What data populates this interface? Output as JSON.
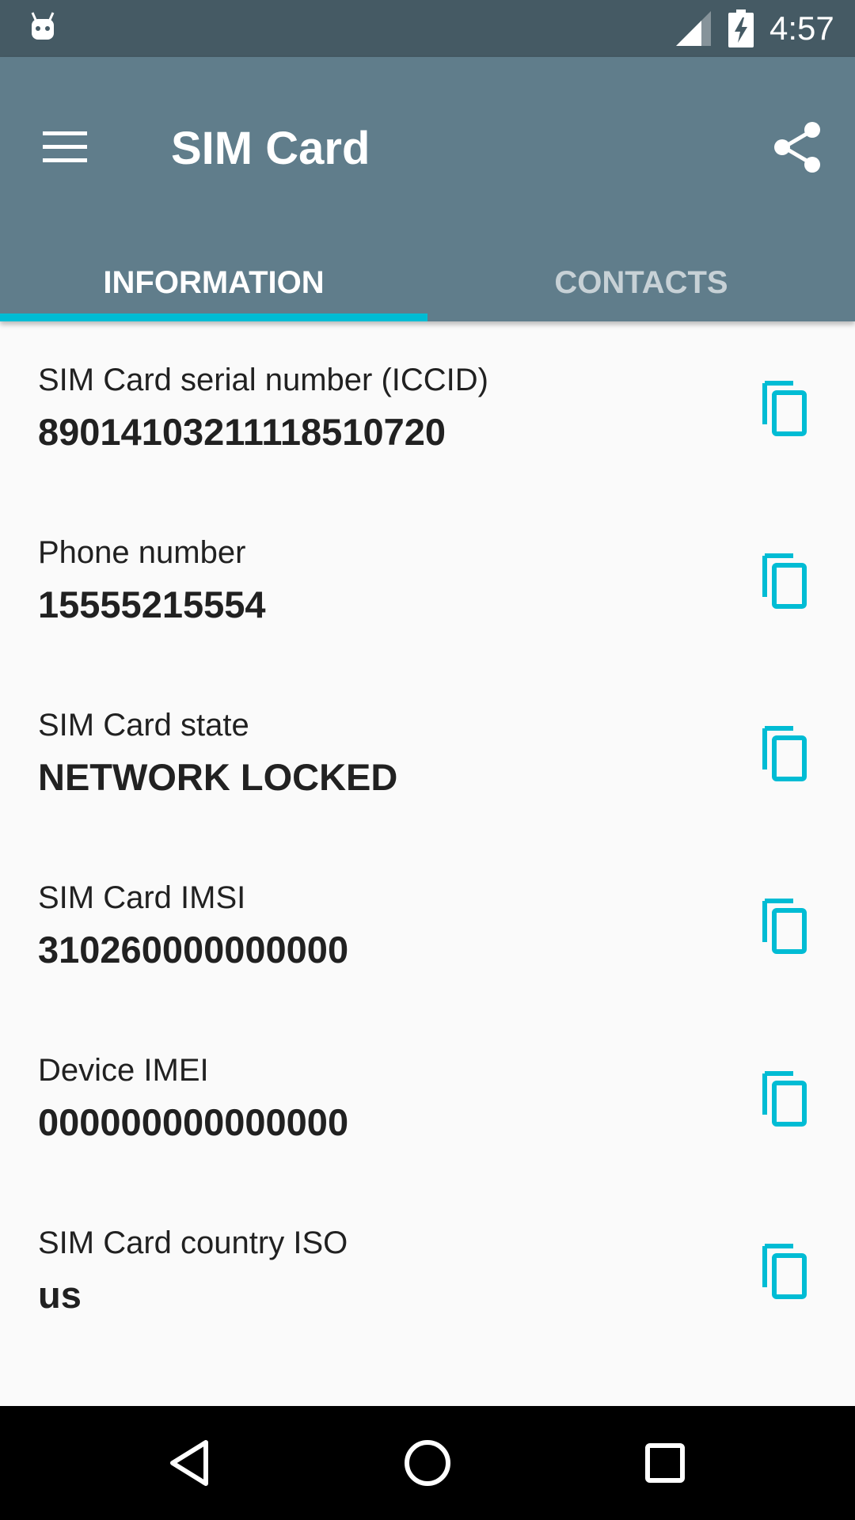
{
  "status_bar": {
    "time": "4:57",
    "icons": [
      "android-icon",
      "signal-icon",
      "battery-charging-icon"
    ]
  },
  "app_bar": {
    "title": "SIM Card",
    "menu_icon": "hamburger-menu-icon",
    "share_icon": "share-icon"
  },
  "tabs": [
    {
      "label": "INFORMATION",
      "active": true
    },
    {
      "label": "CONTACTS",
      "active": false
    }
  ],
  "accent_color": "#00bcd4",
  "app_bar_color": "#607d8b",
  "status_bar_color": "#455a64",
  "info_items": [
    {
      "label": "SIM Card serial number (ICCID)",
      "value": "8901410321111851072​0"
    },
    {
      "label": "Phone number",
      "value": "15555215554"
    },
    {
      "label": "SIM Card state",
      "value": "NETWORK LOCKED"
    },
    {
      "label": "SIM Card IMSI",
      "value": "310260000000000"
    },
    {
      "label": "Device IMEI",
      "value": "000000000000000"
    },
    {
      "label": "SIM Card country ISO",
      "value": "us"
    }
  ],
  "copy_icon": "copy-icon",
  "nav_bar": {
    "icons": [
      "back-icon",
      "home-icon",
      "recents-icon"
    ]
  }
}
